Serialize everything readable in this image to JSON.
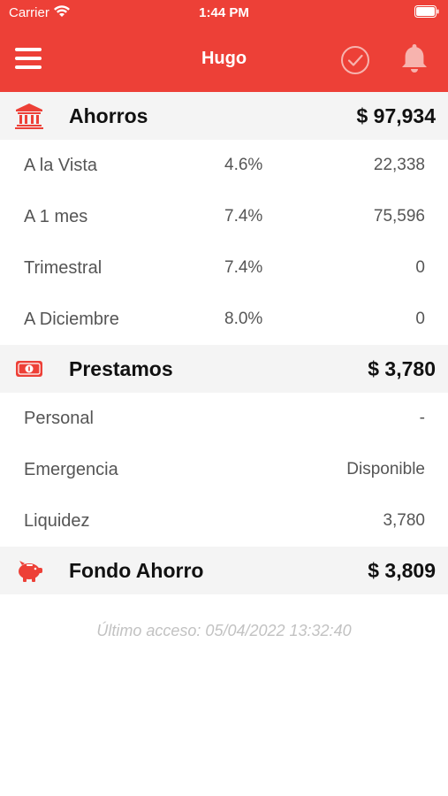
{
  "status_bar": {
    "carrier": "Carrier",
    "time": "1:44 PM"
  },
  "header": {
    "title": "Hugo",
    "accent_color": "#ed4037"
  },
  "sections": {
    "ahorros": {
      "title": "Ahorros",
      "total": "$ 97,934",
      "icon": "bank-icon",
      "rows": [
        {
          "label": "A la Vista",
          "rate": "4.6%",
          "amount": "22,338"
        },
        {
          "label": "A 1 mes",
          "rate": "7.4%",
          "amount": "75,596"
        },
        {
          "label": "Trimestral",
          "rate": "7.4%",
          "amount": "0"
        },
        {
          "label": "A Diciembre",
          "rate": "8.0%",
          "amount": "0"
        }
      ]
    },
    "prestamos": {
      "title": "Prestamos",
      "total": "$ 3,780",
      "icon": "money-icon",
      "rows": [
        {
          "label": "Personal",
          "amount": "-"
        },
        {
          "label": "Emergencia",
          "amount": "Disponible"
        },
        {
          "label": "Liquidez",
          "amount": "3,780"
        }
      ]
    },
    "fondo": {
      "title": "Fondo Ahorro",
      "total": "$ 3,809",
      "icon": "piggy-bank-icon"
    }
  },
  "footer": {
    "last_access": "Último acceso: 05/04/2022 13:32:40"
  }
}
